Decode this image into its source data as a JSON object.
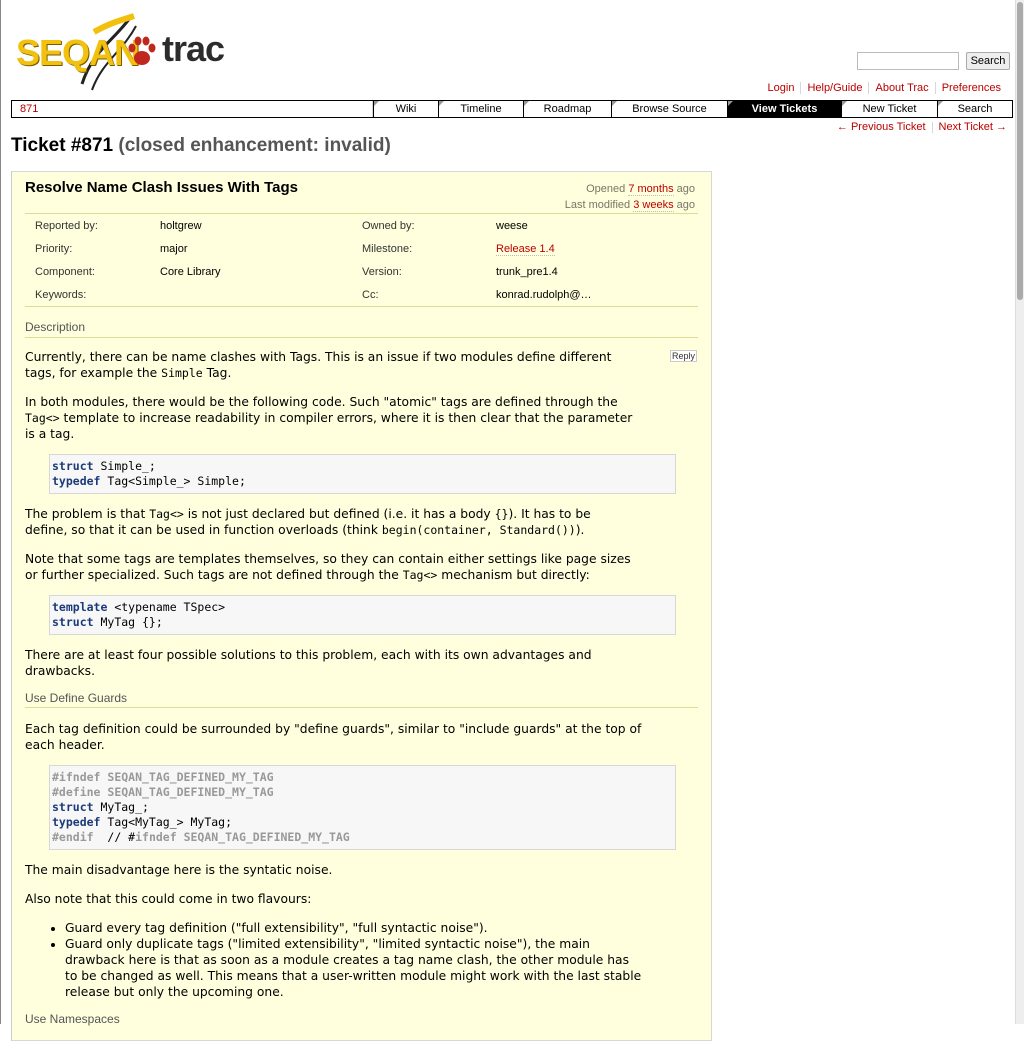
{
  "logo": {
    "seqan": "SEQAN",
    "trac": "trac"
  },
  "search": {
    "placeholder": "",
    "button": "Search"
  },
  "metanav": [
    "Login",
    "Help/Guide",
    "About Trac",
    "Preferences"
  ],
  "mainnav": {
    "context": "871",
    "tabs": [
      "Wiki",
      "Timeline",
      "Roadmap",
      "Browse Source",
      "View Tickets",
      "New Ticket",
      "Search"
    ],
    "active": "View Tickets"
  },
  "ctxnav": {
    "prev": "← Previous Ticket",
    "next": "Next Ticket →"
  },
  "ticket": {
    "title": "Ticket #871",
    "status": "(closed enhancement: invalid)",
    "summary": "Resolve Name Clash Issues With Tags",
    "opened_prefix": "Opened",
    "opened": "7 months",
    "opened_suffix": "ago",
    "modified_prefix": "Last modified",
    "modified": "3 weeks",
    "modified_suffix": "ago",
    "props": {
      "reported_by_label": "Reported by:",
      "reported_by": "holtgrew",
      "owned_by_label": "Owned by:",
      "owned_by": "weese",
      "priority_label": "Priority:",
      "priority": "major",
      "milestone_label": "Milestone:",
      "milestone": "Release 1.4",
      "component_label": "Component:",
      "component": "Core Library",
      "version_label": "Version:",
      "version": "trunk_pre1.4",
      "keywords_label": "Keywords:",
      "keywords": "",
      "cc_label": "Cc:",
      "cc": "konrad.rudolph@…"
    },
    "description_label": "Description",
    "reply": "Reply"
  },
  "body": {
    "p1a": "Currently, there can be name clashes with Tags. This is an issue if two modules define different",
    "p1b": "tags, for example the",
    "p1code": "Simple",
    "p1c": "Tag.",
    "p2a": "In both modules, there would be the following code. Such \"atomic\" tags are defined through the",
    "p2code": "Tag<>",
    "p2b": "template to increase readability in compiler errors, where it is then clear that the parameter",
    "p2c": "is a tag.",
    "code1": {
      "l1kw": "struct",
      "l1": " Simple_;",
      "l2kw": "typedef",
      "l2": " Tag<Simple_> Simple;"
    },
    "p3a": "The problem is that",
    "p3code1": "Tag<>",
    "p3b": "is not just declared but defined (i.e. it has a body",
    "p3code2": "{}",
    "p3c": "). It has to be",
    "p3d": "define, so that it can be used in function overloads (think",
    "p3code3": "begin(container, Standard())",
    "p3e": ").",
    "p4a": "Note that some tags are templates themselves, so they can contain either settings like page sizes",
    "p4b": "or further specialized. Such tags are not defined through the",
    "p4code": "Tag<>",
    "p4c": "mechanism but directly:",
    "code2": {
      "l1kw": "template",
      "l1": " <typename TSpec>",
      "l2kw": "struct",
      "l2": " MyTag {};"
    },
    "p5a": "There are at least four possible solutions to this problem, each with its own advantages and",
    "p5b": "drawbacks.",
    "h_guards": "Use Define Guards",
    "p6a": "Each tag definition could be surrounded by \"define guards\", similar to \"include guards\" at the top of",
    "p6b": "each header.",
    "code3": {
      "l1a": "#ifndef",
      "l1b": " SEQAN_TAG_DEFINED_MY_TAG",
      "l2a": "#define",
      "l2b": " SEQAN_TAG_DEFINED_MY_TAG",
      "l3kw": "struct",
      "l3": " MyTag_;",
      "l4kw": "typedef",
      "l4": " Tag<MyTag_> MyTag;",
      "l5a": "#endif",
      "l5b": "  // #",
      "l5c": "ifndef",
      "l5d": " SEQAN_TAG_DEFINED_MY_TAG"
    },
    "p7": "The main disadvantage here is the syntatic noise.",
    "p8": "Also note that this could come in two flavours:",
    "li1": "Guard every tag definition (\"full extensibility\", \"full syntactic noise\").",
    "li2a": "Guard only duplicate tags (\"limited extensibility\", \"limited syntactic noise\"), the main",
    "li2b": "drawback here is that as soon as a module creates a tag name clash, the other module has",
    "li2c": "to be changed as well. This means that a user-written module might work with the last stable",
    "li2d": "release but only the upcoming one.",
    "h_namespaces": "Use Namespaces"
  }
}
